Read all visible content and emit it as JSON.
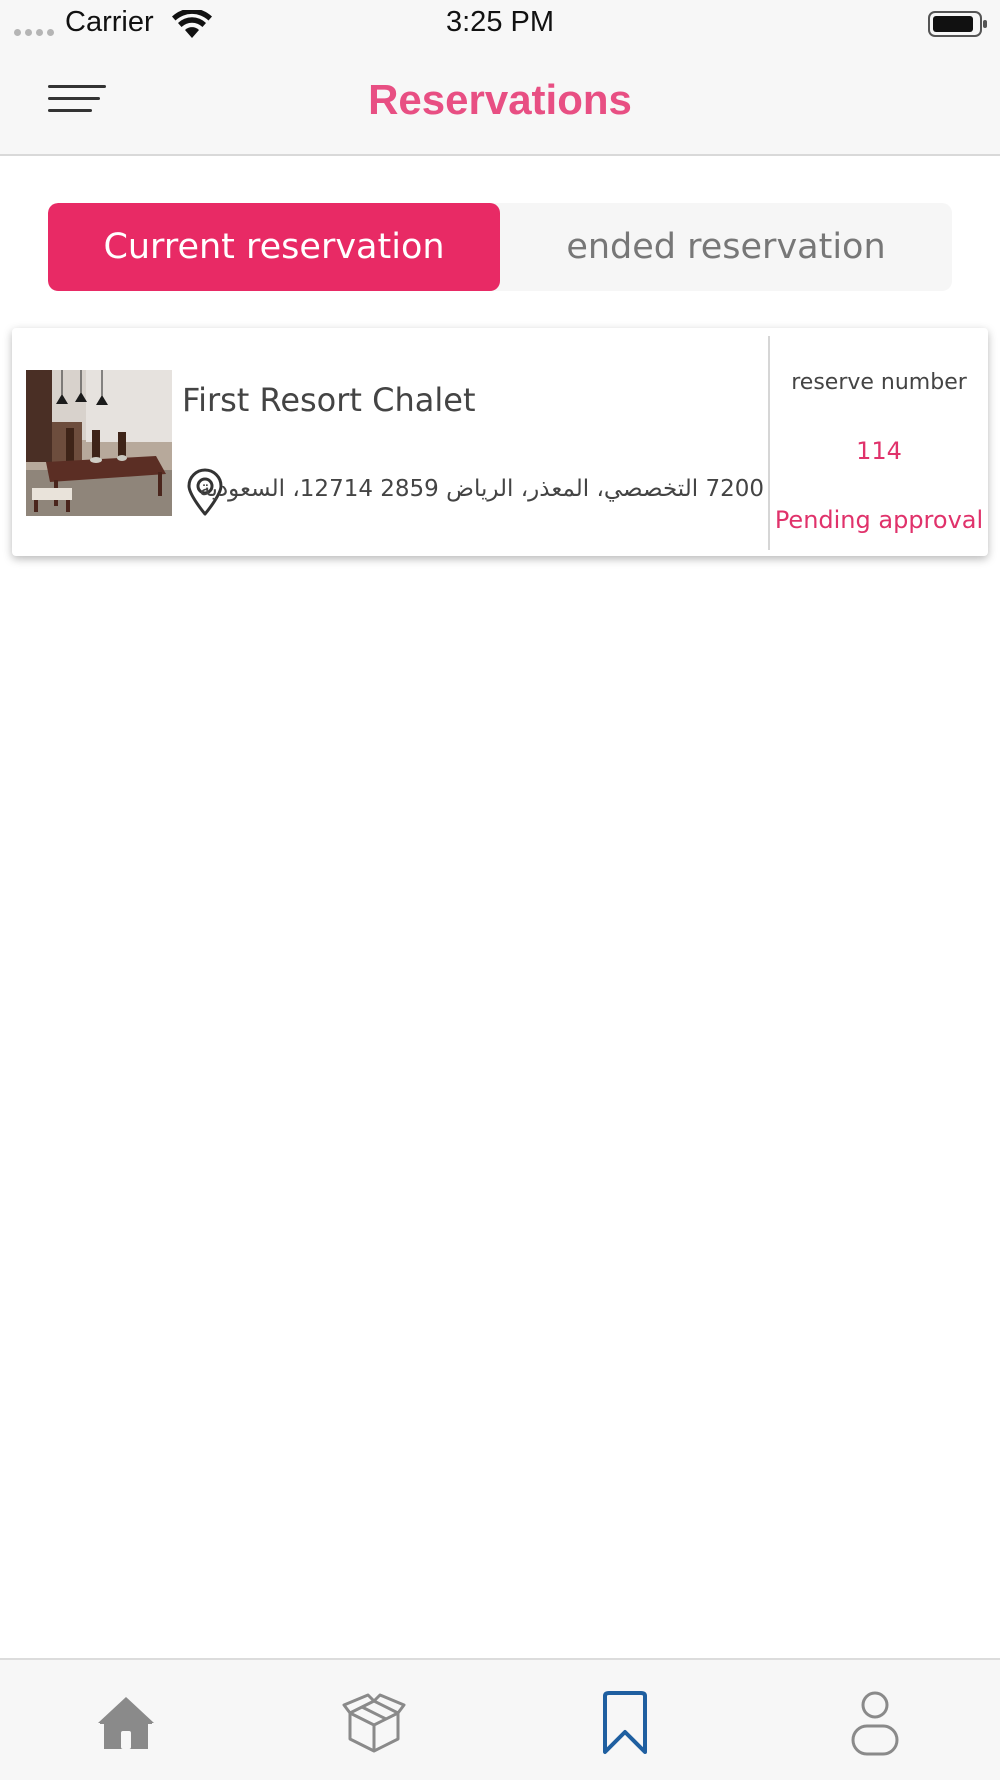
{
  "status_bar": {
    "carrier": "Carrier",
    "time": "3:25 PM"
  },
  "header": {
    "title": "Reservations",
    "title_color": "#e84f83",
    "menu_icon": "hamburger-menu-icon"
  },
  "tabs": [
    {
      "label": "Current reservation",
      "active": true
    },
    {
      "label": "ended reservation",
      "active": false
    }
  ],
  "accent_color": "#e82a65",
  "reservations": [
    {
      "name": "First Resort Chalet",
      "address": "7200 التخصصي، المعذر، الرياض 2859 12714، السعودية",
      "reserve_label": "reserve number",
      "reserve_number": "114",
      "status": "Pending approval",
      "location_icon": "location-pin-icon"
    }
  ],
  "tab_bar": {
    "items": [
      {
        "icon": "home-icon",
        "active": false
      },
      {
        "icon": "box-icon",
        "active": false
      },
      {
        "icon": "bookmark-icon",
        "active": true
      },
      {
        "icon": "profile-icon",
        "active": false
      }
    ],
    "active_color": "#1f5fa0",
    "inactive_color": "#8a8a8a"
  }
}
